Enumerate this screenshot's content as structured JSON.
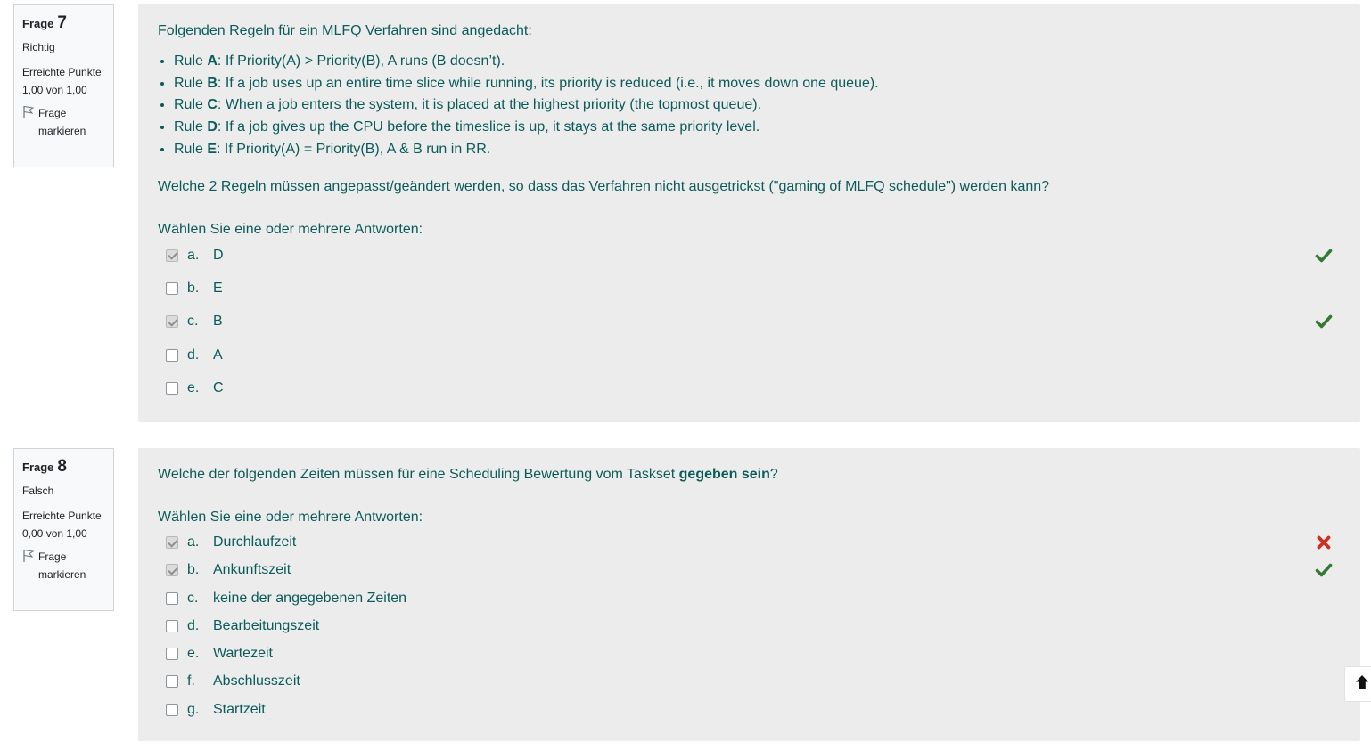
{
  "questions": [
    {
      "label": "Frage",
      "number": "7",
      "state": "Richtig",
      "grade": "Erreichte Punkte 1,00 von 1,00",
      "flag_label": "Frage markieren",
      "intro": "Folgenden Regeln für ein MLFQ Verfahren sind angedacht:",
      "rules": [
        {
          "prefix": "Rule ",
          "name": "A",
          "text": ": If Priority(A) > Priority(B), A runs (B doesn’t)."
        },
        {
          "prefix": "Rule ",
          "name": "B",
          "text": ": If a job uses up an entire time slice while running, its priority is reduced (i.e., it moves down one queue)."
        },
        {
          "prefix": "Rule ",
          "name": "C",
          "text": ": When a job enters the system, it is placed at the highest priority (the topmost queue)."
        },
        {
          "prefix": "Rule ",
          "name": "D",
          "text": ": If a job gives up the CPU before the timeslice is up, it stays at the same priority level."
        },
        {
          "prefix": "Rule ",
          "name": "E",
          "text": ": If Priority(A) = Priority(B), A & B run in RR."
        }
      ],
      "question": "Welche 2 Regeln müssen angepasst/geändert werden, so dass das Verfahren nicht ausgetrickst (\"gaming of MLFQ schedule\") werden kann?",
      "prompt": "Wählen Sie eine oder mehrere Antworten:",
      "answers": [
        {
          "letter": "a.",
          "text": "D",
          "checked": true,
          "mark": "correct-icon"
        },
        {
          "letter": "b.",
          "text": "E",
          "checked": false,
          "mark": ""
        },
        {
          "letter": "c.",
          "text": "B",
          "checked": true,
          "mark": "correct-icon"
        },
        {
          "letter": "d.",
          "text": "A",
          "checked": false,
          "mark": ""
        },
        {
          "letter": "e.",
          "text": "C",
          "checked": false,
          "mark": ""
        }
      ]
    },
    {
      "label": "Frage",
      "number": "8",
      "state": "Falsch",
      "grade": "Erreichte Punkte 0,00 von 1,00",
      "flag_label": "Frage markieren",
      "question_before": "Welche der folgenden Zeiten müssen für eine Scheduling Bewertung vom Taskset ",
      "question_bold": "gegeben sein",
      "question_after": "?",
      "prompt": "Wählen Sie eine oder mehrere Antworten:",
      "answers": [
        {
          "letter": "a.",
          "text": "Durchlaufzeit",
          "checked": true,
          "mark": "incorrect-icon"
        },
        {
          "letter": "b.",
          "text": "Ankunftszeit",
          "checked": true,
          "mark": "correct-icon"
        },
        {
          "letter": "c.",
          "text": "keine der angegebenen Zeiten",
          "checked": false,
          "mark": ""
        },
        {
          "letter": "d.",
          "text": "Bearbeitungszeit",
          "checked": false,
          "mark": ""
        },
        {
          "letter": "e.",
          "text": "Wartezeit",
          "checked": false,
          "mark": ""
        },
        {
          "letter": "f.",
          "text": "Abschlusszeit",
          "checked": false,
          "mark": ""
        },
        {
          "letter": "g.",
          "text": "Startzeit",
          "checked": false,
          "mark": ""
        }
      ]
    }
  ],
  "scroll_top_icon": "arrow-up-icon",
  "colors": {
    "text": "#0b5b5b",
    "correct": "#357a32",
    "incorrect": "#ca3120",
    "content_bg": "#ececec"
  }
}
